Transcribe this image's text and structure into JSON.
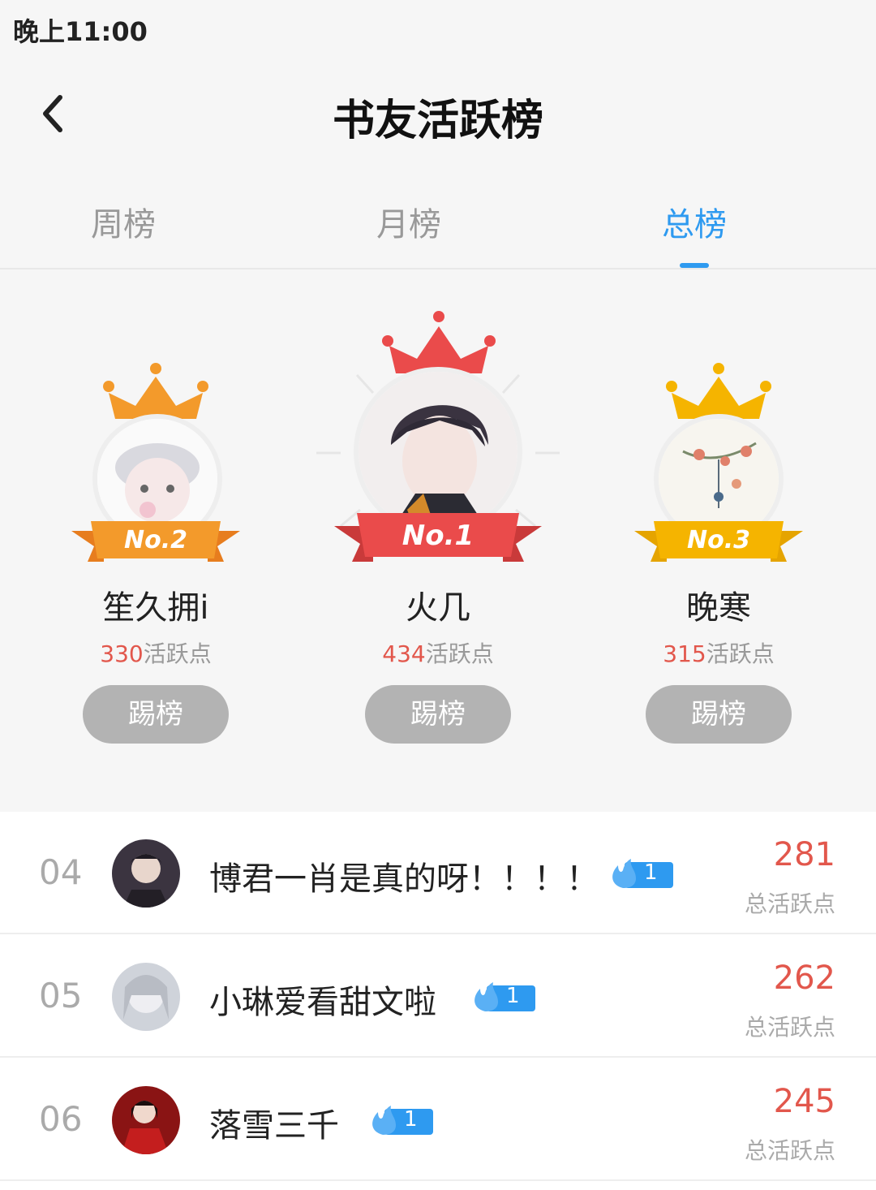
{
  "status": {
    "time": "晚上11:00"
  },
  "header": {
    "title": "书友活跃榜"
  },
  "tabs": [
    {
      "label": "周榜",
      "active": false
    },
    {
      "label": "月榜",
      "active": false
    },
    {
      "label": "总榜",
      "active": true
    }
  ],
  "colors": {
    "accent": "#2e9af0",
    "score": "#e2574c",
    "gold": "#f5b400",
    "silver_ribbon": "#f39a2b",
    "first_ribbon": "#ea4b4b",
    "button": "#b3b3b3"
  },
  "podium": [
    {
      "rank_label": "No.2",
      "name": "笙久拥i",
      "points": "330",
      "points_unit": "活跃点",
      "button": "踢榜"
    },
    {
      "rank_label": "No.1",
      "name": "火几",
      "points": "434",
      "points_unit": "活跃点",
      "button": "踢榜"
    },
    {
      "rank_label": "No.3",
      "name": "晚寒",
      "points": "315",
      "points_unit": "活跃点",
      "button": "踢榜"
    }
  ],
  "list": [
    {
      "rank": "04",
      "name": "博君一肖是真的呀！！！！",
      "badge": "1",
      "score": "281",
      "score_label": "总活跃点"
    },
    {
      "rank": "05",
      "name": "小琳爱看甜文啦",
      "badge": "1",
      "score": "262",
      "score_label": "总活跃点"
    },
    {
      "rank": "06",
      "name": "落雪三千",
      "badge": "1",
      "score": "245",
      "score_label": "总活跃点"
    }
  ]
}
